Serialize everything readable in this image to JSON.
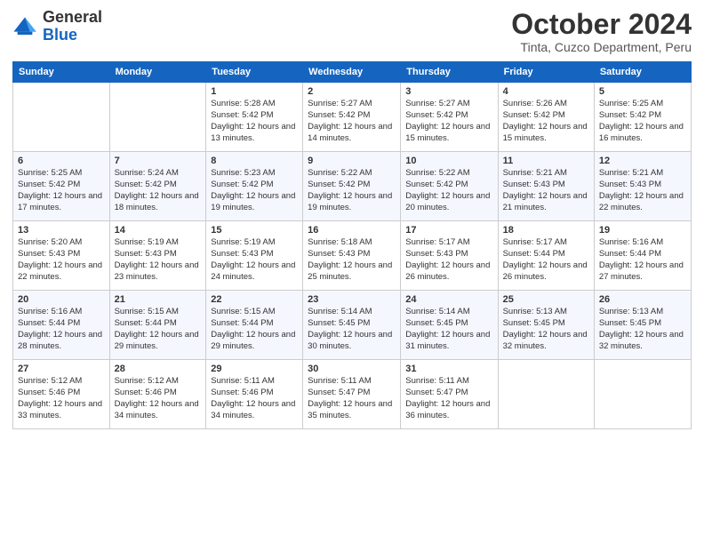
{
  "logo": {
    "general": "General",
    "blue": "Blue"
  },
  "header": {
    "month": "October 2024",
    "location": "Tinta, Cuzco Department, Peru"
  },
  "weekdays": [
    "Sunday",
    "Monday",
    "Tuesday",
    "Wednesday",
    "Thursday",
    "Friday",
    "Saturday"
  ],
  "weeks": [
    [
      {
        "day": "",
        "sunrise": "",
        "sunset": "",
        "daylight": ""
      },
      {
        "day": "",
        "sunrise": "",
        "sunset": "",
        "daylight": ""
      },
      {
        "day": "1",
        "sunrise": "Sunrise: 5:28 AM",
        "sunset": "Sunset: 5:42 PM",
        "daylight": "Daylight: 12 hours and 13 minutes."
      },
      {
        "day": "2",
        "sunrise": "Sunrise: 5:27 AM",
        "sunset": "Sunset: 5:42 PM",
        "daylight": "Daylight: 12 hours and 14 minutes."
      },
      {
        "day": "3",
        "sunrise": "Sunrise: 5:27 AM",
        "sunset": "Sunset: 5:42 PM",
        "daylight": "Daylight: 12 hours and 15 minutes."
      },
      {
        "day": "4",
        "sunrise": "Sunrise: 5:26 AM",
        "sunset": "Sunset: 5:42 PM",
        "daylight": "Daylight: 12 hours and 15 minutes."
      },
      {
        "day": "5",
        "sunrise": "Sunrise: 5:25 AM",
        "sunset": "Sunset: 5:42 PM",
        "daylight": "Daylight: 12 hours and 16 minutes."
      }
    ],
    [
      {
        "day": "6",
        "sunrise": "Sunrise: 5:25 AM",
        "sunset": "Sunset: 5:42 PM",
        "daylight": "Daylight: 12 hours and 17 minutes."
      },
      {
        "day": "7",
        "sunrise": "Sunrise: 5:24 AM",
        "sunset": "Sunset: 5:42 PM",
        "daylight": "Daylight: 12 hours and 18 minutes."
      },
      {
        "day": "8",
        "sunrise": "Sunrise: 5:23 AM",
        "sunset": "Sunset: 5:42 PM",
        "daylight": "Daylight: 12 hours and 19 minutes."
      },
      {
        "day": "9",
        "sunrise": "Sunrise: 5:22 AM",
        "sunset": "Sunset: 5:42 PM",
        "daylight": "Daylight: 12 hours and 19 minutes."
      },
      {
        "day": "10",
        "sunrise": "Sunrise: 5:22 AM",
        "sunset": "Sunset: 5:42 PM",
        "daylight": "Daylight: 12 hours and 20 minutes."
      },
      {
        "day": "11",
        "sunrise": "Sunrise: 5:21 AM",
        "sunset": "Sunset: 5:43 PM",
        "daylight": "Daylight: 12 hours and 21 minutes."
      },
      {
        "day": "12",
        "sunrise": "Sunrise: 5:21 AM",
        "sunset": "Sunset: 5:43 PM",
        "daylight": "Daylight: 12 hours and 22 minutes."
      }
    ],
    [
      {
        "day": "13",
        "sunrise": "Sunrise: 5:20 AM",
        "sunset": "Sunset: 5:43 PM",
        "daylight": "Daylight: 12 hours and 22 minutes."
      },
      {
        "day": "14",
        "sunrise": "Sunrise: 5:19 AM",
        "sunset": "Sunset: 5:43 PM",
        "daylight": "Daylight: 12 hours and 23 minutes."
      },
      {
        "day": "15",
        "sunrise": "Sunrise: 5:19 AM",
        "sunset": "Sunset: 5:43 PM",
        "daylight": "Daylight: 12 hours and 24 minutes."
      },
      {
        "day": "16",
        "sunrise": "Sunrise: 5:18 AM",
        "sunset": "Sunset: 5:43 PM",
        "daylight": "Daylight: 12 hours and 25 minutes."
      },
      {
        "day": "17",
        "sunrise": "Sunrise: 5:17 AM",
        "sunset": "Sunset: 5:43 PM",
        "daylight": "Daylight: 12 hours and 26 minutes."
      },
      {
        "day": "18",
        "sunrise": "Sunrise: 5:17 AM",
        "sunset": "Sunset: 5:44 PM",
        "daylight": "Daylight: 12 hours and 26 minutes."
      },
      {
        "day": "19",
        "sunrise": "Sunrise: 5:16 AM",
        "sunset": "Sunset: 5:44 PM",
        "daylight": "Daylight: 12 hours and 27 minutes."
      }
    ],
    [
      {
        "day": "20",
        "sunrise": "Sunrise: 5:16 AM",
        "sunset": "Sunset: 5:44 PM",
        "daylight": "Daylight: 12 hours and 28 minutes."
      },
      {
        "day": "21",
        "sunrise": "Sunrise: 5:15 AM",
        "sunset": "Sunset: 5:44 PM",
        "daylight": "Daylight: 12 hours and 29 minutes."
      },
      {
        "day": "22",
        "sunrise": "Sunrise: 5:15 AM",
        "sunset": "Sunset: 5:44 PM",
        "daylight": "Daylight: 12 hours and 29 minutes."
      },
      {
        "day": "23",
        "sunrise": "Sunrise: 5:14 AM",
        "sunset": "Sunset: 5:45 PM",
        "daylight": "Daylight: 12 hours and 30 minutes."
      },
      {
        "day": "24",
        "sunrise": "Sunrise: 5:14 AM",
        "sunset": "Sunset: 5:45 PM",
        "daylight": "Daylight: 12 hours and 31 minutes."
      },
      {
        "day": "25",
        "sunrise": "Sunrise: 5:13 AM",
        "sunset": "Sunset: 5:45 PM",
        "daylight": "Daylight: 12 hours and 32 minutes."
      },
      {
        "day": "26",
        "sunrise": "Sunrise: 5:13 AM",
        "sunset": "Sunset: 5:45 PM",
        "daylight": "Daylight: 12 hours and 32 minutes."
      }
    ],
    [
      {
        "day": "27",
        "sunrise": "Sunrise: 5:12 AM",
        "sunset": "Sunset: 5:46 PM",
        "daylight": "Daylight: 12 hours and 33 minutes."
      },
      {
        "day": "28",
        "sunrise": "Sunrise: 5:12 AM",
        "sunset": "Sunset: 5:46 PM",
        "daylight": "Daylight: 12 hours and 34 minutes."
      },
      {
        "day": "29",
        "sunrise": "Sunrise: 5:11 AM",
        "sunset": "Sunset: 5:46 PM",
        "daylight": "Daylight: 12 hours and 34 minutes."
      },
      {
        "day": "30",
        "sunrise": "Sunrise: 5:11 AM",
        "sunset": "Sunset: 5:47 PM",
        "daylight": "Daylight: 12 hours and 35 minutes."
      },
      {
        "day": "31",
        "sunrise": "Sunrise: 5:11 AM",
        "sunset": "Sunset: 5:47 PM",
        "daylight": "Daylight: 12 hours and 36 minutes."
      },
      {
        "day": "",
        "sunrise": "",
        "sunset": "",
        "daylight": ""
      },
      {
        "day": "",
        "sunrise": "",
        "sunset": "",
        "daylight": ""
      }
    ]
  ]
}
